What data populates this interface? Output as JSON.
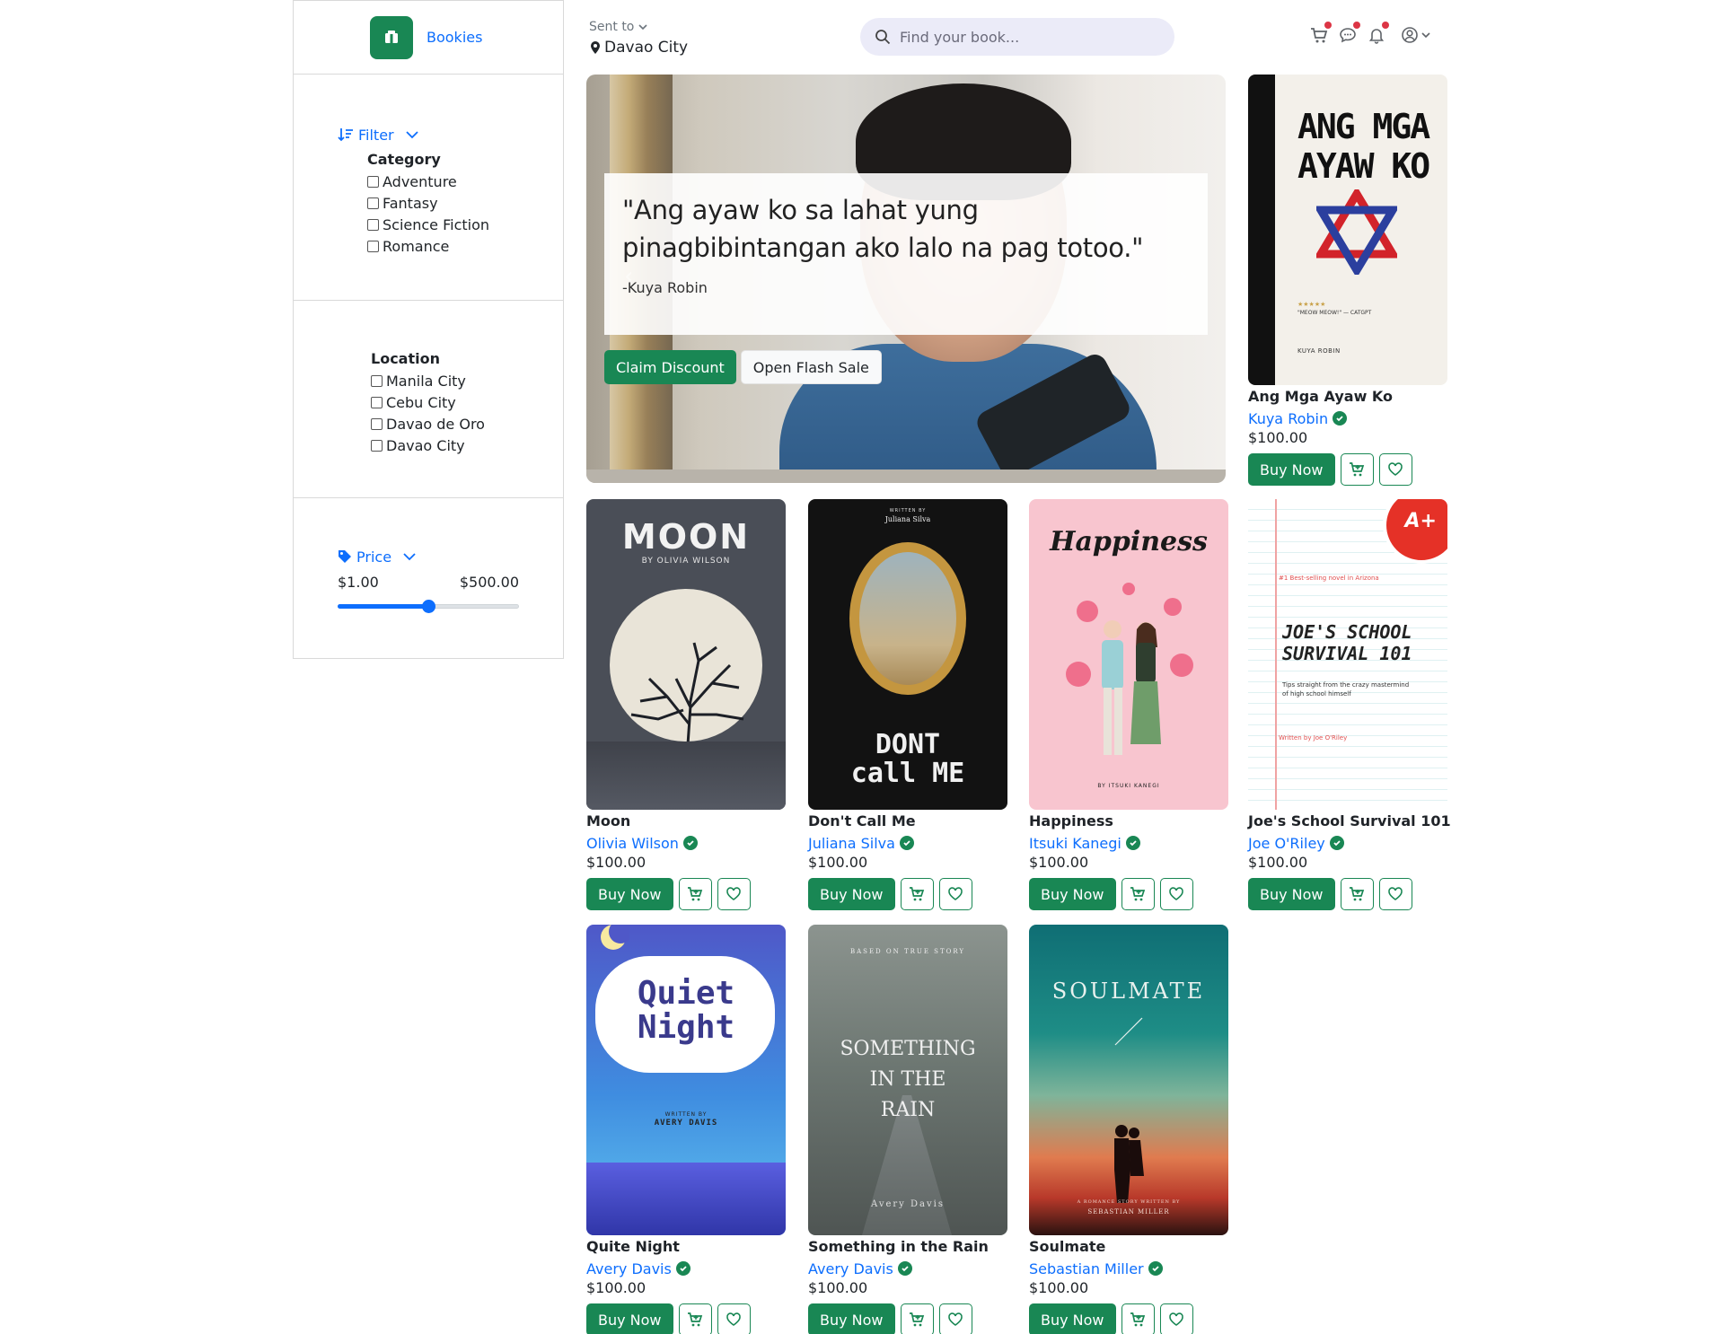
{
  "brand": {
    "name": "Bookies"
  },
  "header": {
    "sent_to_label": "Sent to",
    "city": "Davao City",
    "search_placeholder": "Find your book..."
  },
  "filters": {
    "filter_label": "Filter",
    "category_title": "Category",
    "categories": [
      "Adventure",
      "Fantasy",
      "Science Fiction",
      "Romance"
    ],
    "location_title": "Location",
    "locations": [
      "Manila City",
      "Cebu City",
      "Davao de Oro",
      "Davao City"
    ],
    "price_label": "Price",
    "price_min": "$1.00",
    "price_max": "$500.00",
    "price_slider_fraction": 0.5
  },
  "hero": {
    "quote": "\"Ang ayaw ko sa lahat yung pinagbibintangan ako lalo na pag totoo.\"",
    "author": "-Kuya Robin",
    "claim_label": "Claim Discount",
    "flash_label": "Open Flash Sale"
  },
  "buttons": {
    "buy": "Buy Now"
  },
  "books": [
    {
      "title": "Ang Mga Ayaw Ko",
      "author": "Kuya Robin",
      "price": "$100.00",
      "cover_title_lines": [
        "ANG MGA",
        "AYAW KO"
      ],
      "cover_quote": "\"MEOW MEOW!\" — CATGPT",
      "cover_stars": "★★★★★",
      "cover_author": "KUYA ROBIN"
    },
    {
      "title": "Moon",
      "author": "Olivia Wilson",
      "price": "$100.00",
      "cover_title": "MOON",
      "cover_by": "BY OLIVIA WILSON"
    },
    {
      "title": "Don't Call Me",
      "author": "Juliana Silva",
      "price": "$100.00",
      "cover_top_small": "WRITTEN BY",
      "cover_top": "Juliana Silva",
      "cover_title_lines": [
        "DONT",
        "call ME"
      ]
    },
    {
      "title": "Happiness",
      "author": "Itsuki Kanegi",
      "price": "$100.00",
      "cover_title": "Happiness",
      "cover_by": "BY ITSUKI KANEGI"
    },
    {
      "title": "Joe's School Survival 101",
      "author": "Joe O'Riley",
      "price": "$100.00",
      "cover_badge": "A+",
      "cover_tag": "#1 Best-selling novel in Arizona",
      "cover_title_lines": [
        "JOE'S SCHOOL",
        "SURVIVAL  101"
      ],
      "cover_sub": "Tips straight from the crazy mastermind of high school himself",
      "cover_by": "Written by Joe O'Riley"
    },
    {
      "title": "Quite Night",
      "author": "Avery Davis",
      "price": "$100.00",
      "cover_title_lines": [
        "Quiet",
        "Night"
      ],
      "cover_by_small": "WRITTEN BY",
      "cover_by": "AVERY DAVIS"
    },
    {
      "title": "Something in the Rain",
      "author": "Avery Davis",
      "price": "$100.00",
      "cover_top": "BASED ON TRUE STORY",
      "cover_title_lines": [
        "SOMETHING",
        "IN THE",
        "RAIN"
      ],
      "cover_author": "Avery Davis"
    },
    {
      "title": "Soulmate",
      "author": "Sebastian Miller",
      "price": "$100.00",
      "cover_title": "SOULMATE",
      "cover_sub": "A ROMANCE STORY WRITTEN BY",
      "cover_author": "SEBASTIAN MILLER"
    }
  ]
}
